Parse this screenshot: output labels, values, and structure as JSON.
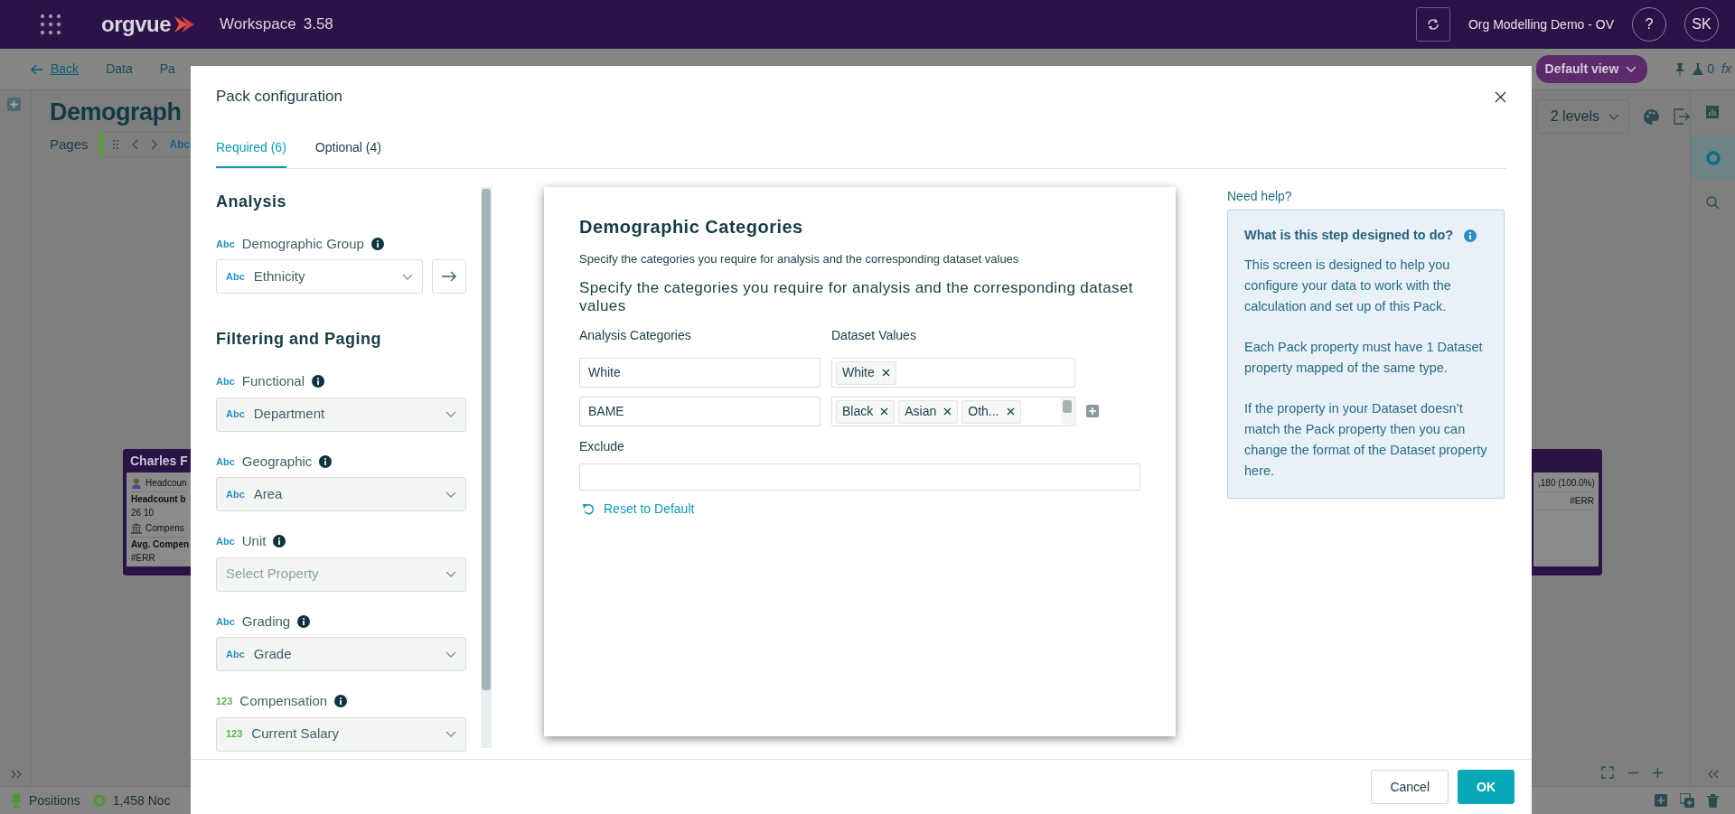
{
  "app_bar": {
    "logo": "orgvue",
    "workspace": "Workspace",
    "version": "3.58",
    "org": "Org Modelling Demo - OV",
    "help": "?",
    "user": "SK"
  },
  "toolbar": {
    "back": "Back",
    "menu": [
      "Data",
      "Pa"
    ],
    "view": "Default view",
    "alerts": "0",
    "formula": "fx"
  },
  "page": {
    "title": "Demograph",
    "pages_label": "Pages",
    "page_tag": "Abc",
    "levels": "2 levels"
  },
  "right_rail": [
    {
      "selected": false
    },
    {
      "selected": true
    },
    {
      "selected": false
    }
  ],
  "cards": [
    {
      "title": "Charles F",
      "lines": [
        {
          "kind": "metric",
          "text": "Headcoun"
        },
        {
          "kind": "heading",
          "text": "Headcount b"
        },
        {
          "kind": "value",
          "text": "26  10"
        },
        {
          "kind": "metric",
          "text": "Compens"
        },
        {
          "kind": "heading",
          "text": "Avg. Compen"
        },
        {
          "kind": "value",
          "text": "#ERR"
        }
      ]
    },
    {
      "lines": [
        {
          "kind": "metric",
          "text": ",180 (100.0%)"
        },
        {
          "kind": "metric",
          "text": "#ERR"
        }
      ]
    }
  ],
  "status_bar": {
    "positions": "Positions",
    "nodes": "1,458 Noc"
  },
  "dialog": {
    "title": "Pack configuration",
    "tabs": [
      {
        "label": "Required (6)",
        "selected": true
      },
      {
        "label": "Optional (4)",
        "selected": false
      }
    ],
    "sections": [
      {
        "heading": "Analysis",
        "fields": [
          {
            "kind": "text",
            "type_tag": "Abc",
            "label": "Demographic Group",
            "value_tag": "Abc",
            "value": "Ethnicity",
            "disabled": false,
            "link_button": true
          }
        ]
      },
      {
        "heading": "Filtering and Paging",
        "fields": [
          {
            "kind": "text",
            "type_tag": "Abc",
            "label": "Functional",
            "value_tag": "Abc",
            "value": "Department",
            "disabled": true,
            "link_button": false
          },
          {
            "kind": "text",
            "type_tag": "Abc",
            "label": "Geographic",
            "value_tag": "Abc",
            "value": "Area",
            "disabled": true,
            "link_button": false
          },
          {
            "kind": "text",
            "type_tag": "Abc",
            "label": "Unit",
            "placeholder": "Select Property",
            "disabled": true,
            "link_button": false
          },
          {
            "kind": "text",
            "type_tag": "Abc",
            "label": "Grading",
            "value_tag": "Abc",
            "value": "Grade",
            "disabled": true,
            "link_button": false
          },
          {
            "kind": "number",
            "type_tag": "123",
            "label": "Compensation",
            "value_tag": "123",
            "value": "Current Salary",
            "disabled": true,
            "link_button": false
          }
        ]
      }
    ],
    "categories": {
      "title": "Demographic Categories",
      "description": "Specify the categories you require for analysis and the corresponding dataset values",
      "prompt": "Specify the categories you require for analysis and the corresponding dataset values",
      "column_headers": [
        "Analysis Categories",
        "Dataset Values"
      ],
      "rows": [
        {
          "category": "White",
          "values": [
            "White"
          ],
          "add_button": false
        },
        {
          "category": "BAME",
          "values": [
            "Black",
            "Asian",
            "Oth..."
          ],
          "add_button": true
        }
      ],
      "exclude_label": "Exclude",
      "reset": "Reset to Default"
    },
    "help": {
      "title": "Need help?",
      "heading": "What is this step designed to do?",
      "paragraphs": [
        "This screen is designed to help you configure your data to work with the calculation and set up of this Pack.",
        "Each Pack property must have 1 Dataset property mapped of the same type.",
        "If the property in your Dataset doesn’t match the Pack property then you can change the format of the Dataset property here."
      ]
    },
    "buttons": [
      {
        "label": "Cancel",
        "kind": "secondary"
      },
      {
        "label": "OK",
        "kind": "primary"
      }
    ]
  }
}
